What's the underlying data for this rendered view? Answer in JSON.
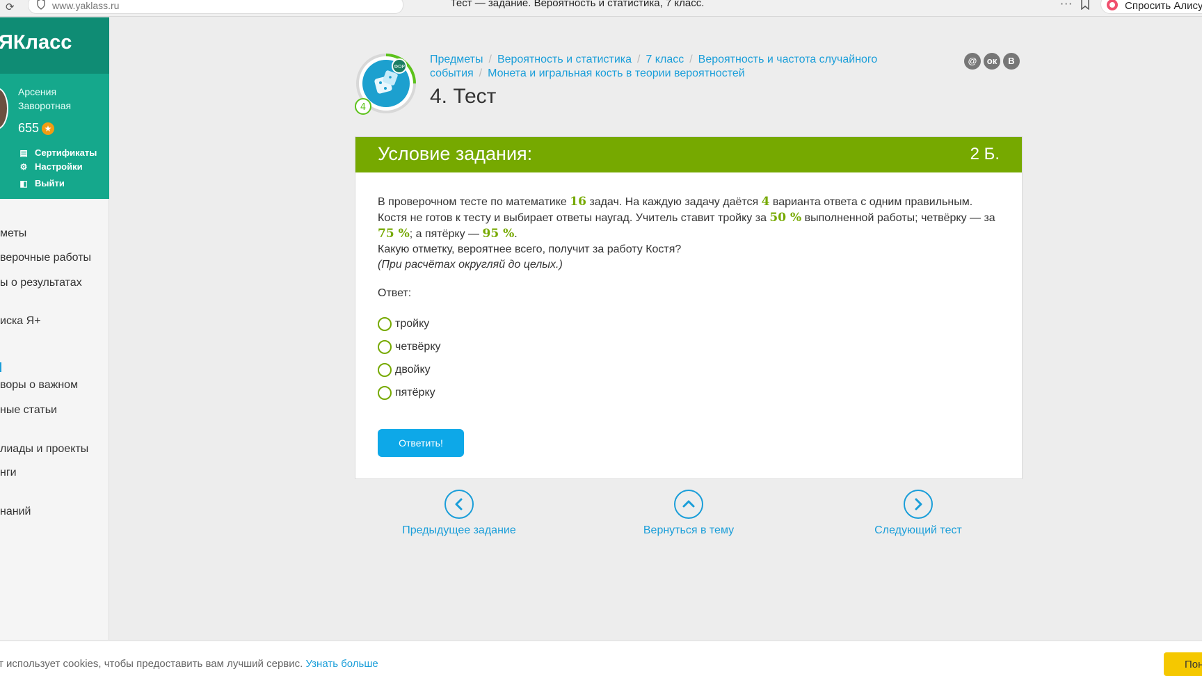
{
  "browser": {
    "url": "www.yaklass.ru",
    "tab_title": "Тест — задание. Вероятность и статистика, 7 класс.",
    "alice_label": "Спросить Алису"
  },
  "sidebar": {
    "logo": "ЯКласс",
    "user_name": "Арсения Заворотная",
    "points": "655",
    "menu": [
      {
        "icon": "certificate-icon",
        "label": "Сертификаты"
      },
      {
        "icon": "gear-icon",
        "label": "Настройки"
      },
      {
        "icon": "logout-icon",
        "label": "Выйти"
      }
    ],
    "nav": [
      "меты",
      "верочные работы",
      "ы о результатах",
      "иска Я+",
      "воры о важном",
      "ные статьи",
      "лиады и проекты",
      "нги",
      "наний"
    ]
  },
  "header": {
    "breadcrumb": [
      "Предметы",
      "Вероятность и статистика",
      "7 класс",
      "Вероятность и частота случайного события",
      "Монета и игральная кость в теории вероятностей"
    ],
    "badge_level": "4",
    "badge_tag": "ФОР",
    "title": "4. Тест",
    "share": [
      "@",
      "ок",
      "В"
    ]
  },
  "task": {
    "header_title": "Условие задания:",
    "score": "2 Б.",
    "t1": "В проверочном тесте по математике ",
    "n1": "16",
    "t2": " задач. На каждую задачу даётся ",
    "n2": "4",
    "t3": " варианта ответа с одним правильным. Костя не готов к тесту и выбирает ответы наугад. Учитель ставит тройку за ",
    "n3": "50 %",
    "t4": " выполненной работы; четвёрку — за ",
    "n4": "75 %",
    "t5": "; а пятёрку — ",
    "n5": "95 %",
    "t6": ".",
    "question": "Какую отметку, вероятнее всего, получит за работу Костя?",
    "hint": "(При расчётах округляй до целых.)",
    "answer_label": "Ответ:",
    "options": [
      "тройку",
      "четвёрку",
      "двойку",
      "пятёрку"
    ],
    "submit_label": "Ответить!"
  },
  "bottom_nav": {
    "prev": "Предыдущее задание",
    "back": "Вернуться в тему",
    "next": "Следующий тест"
  },
  "cookie": {
    "text": "т использует cookies, чтобы предоставить вам лучший сервис.",
    "link": "Узнать больше",
    "button": "Пон"
  },
  "colors": {
    "brand_green": "#76a900",
    "sidebar_teal": "#15a88c",
    "link_blue": "#1a9ed9",
    "button_blue": "#0da8e8",
    "cookie_yellow": "#f5c800"
  }
}
